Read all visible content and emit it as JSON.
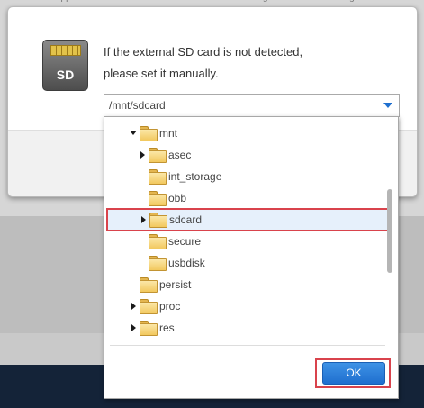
{
  "background": {
    "tabs": [
      "app",
      "sound",
      "setting",
      "images"
    ]
  },
  "dialog": {
    "icon_label": "SD",
    "message_line1": "If the external SD card is not detected,",
    "message_line2": "please set it manually.",
    "path_value": "/mnt/sdcard"
  },
  "tree": {
    "items": [
      {
        "label": "mnt",
        "expander": "down"
      },
      {
        "label": "asec",
        "expander": "right"
      },
      {
        "label": "int_storage",
        "expander": "none"
      },
      {
        "label": "obb",
        "expander": "none"
      },
      {
        "label": "sdcard",
        "expander": "right",
        "selected": true
      },
      {
        "label": "secure",
        "expander": "none"
      },
      {
        "label": "usbdisk",
        "expander": "none"
      },
      {
        "label": "persist",
        "expander": "none"
      },
      {
        "label": "proc",
        "expander": "right"
      },
      {
        "label": "res",
        "expander": "right"
      }
    ]
  },
  "ok_label": "OK",
  "colors": {
    "accent": "#1f6fcf",
    "highlight_outline": "#d9434c",
    "selected_row": "#e6f0fb"
  }
}
